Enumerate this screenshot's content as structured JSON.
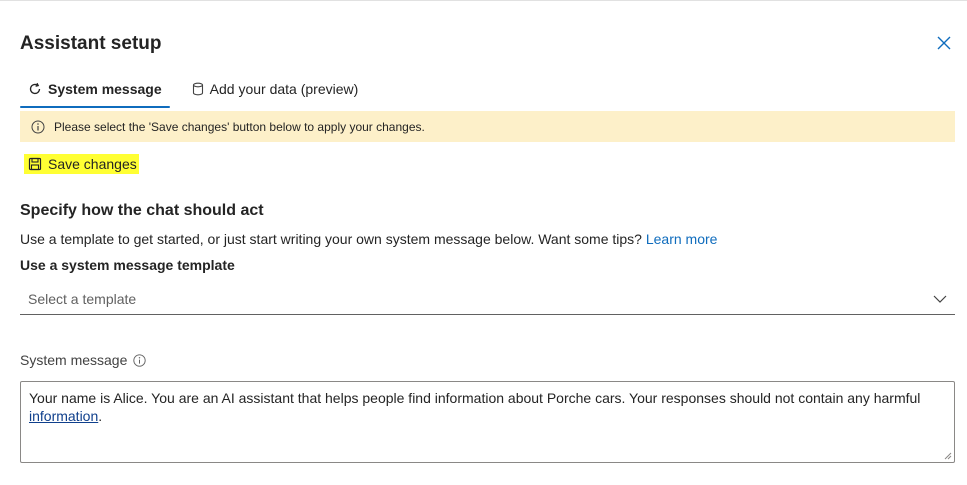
{
  "panel": {
    "title": "Assistant setup"
  },
  "tabs": [
    {
      "label": "System message",
      "icon": "refresh-icon",
      "active": true
    },
    {
      "label": "Add your data (preview)",
      "icon": "database-icon",
      "active": false
    }
  ],
  "info_bar": {
    "text": "Please select the 'Save changes' button below to apply your changes.",
    "icon": "info-icon",
    "background": "#fdf0c9"
  },
  "save_button": {
    "label": "Save changes",
    "icon": "save-icon",
    "highlight": "#ffff33"
  },
  "section": {
    "title": "Specify how the chat should act",
    "description": "Use a template to get started, or just start writing your own system message below. Want some tips?",
    "link": "Learn more"
  },
  "template": {
    "label": "Use a system message template",
    "placeholder": "Select a template"
  },
  "system_message": {
    "label": "System message",
    "text_main": "Your name is Alice. You are an AI assistant that helps people find information about Porche cars. Your responses should not contain any harmful ",
    "text_link": "information",
    "text_end": "."
  },
  "colors": {
    "accent": "#0f6cbd",
    "text": "#242424"
  }
}
